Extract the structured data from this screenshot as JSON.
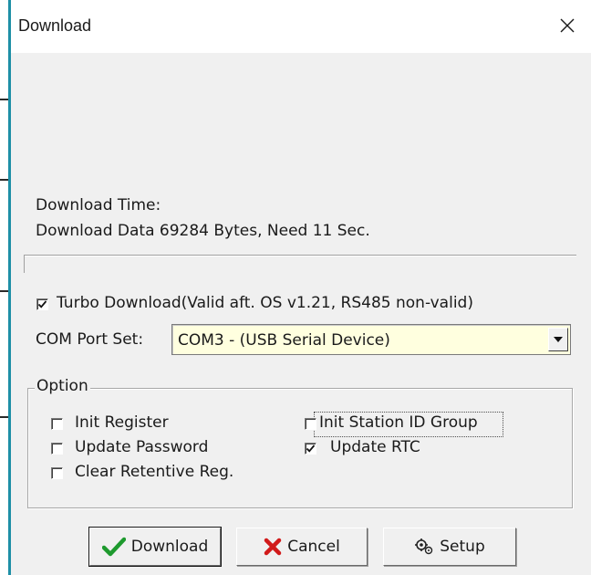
{
  "window": {
    "title": "Download",
    "close_glyph": "✕"
  },
  "info": {
    "time_label": "Download Time:",
    "data_line": "Download Data 69284 Bytes, Need 11 Sec."
  },
  "turbo": {
    "label": "Turbo Download(Valid aft. OS v1.21, RS485 non-valid)",
    "checked": true
  },
  "com_port": {
    "label": "COM Port Set:",
    "value": "COM3 - (USB Serial Device)"
  },
  "option_group": {
    "legend": "Option",
    "items": [
      {
        "label": "Init Register",
        "checked": false
      },
      {
        "label": "Update Password",
        "checked": false
      },
      {
        "label": "Clear Retentive Reg.",
        "checked": false
      },
      {
        "label": "Init Station ID Group",
        "checked": false
      },
      {
        "label": "Update RTC",
        "checked": true
      }
    ]
  },
  "buttons": {
    "download": "Download",
    "cancel": "Cancel",
    "setup": "Setup"
  },
  "colors": {
    "accent_green": "#1e9a2e",
    "cancel_red": "#d11a1a",
    "select_bg": "#ffffdf",
    "left_edge": "#1e8fa6"
  }
}
